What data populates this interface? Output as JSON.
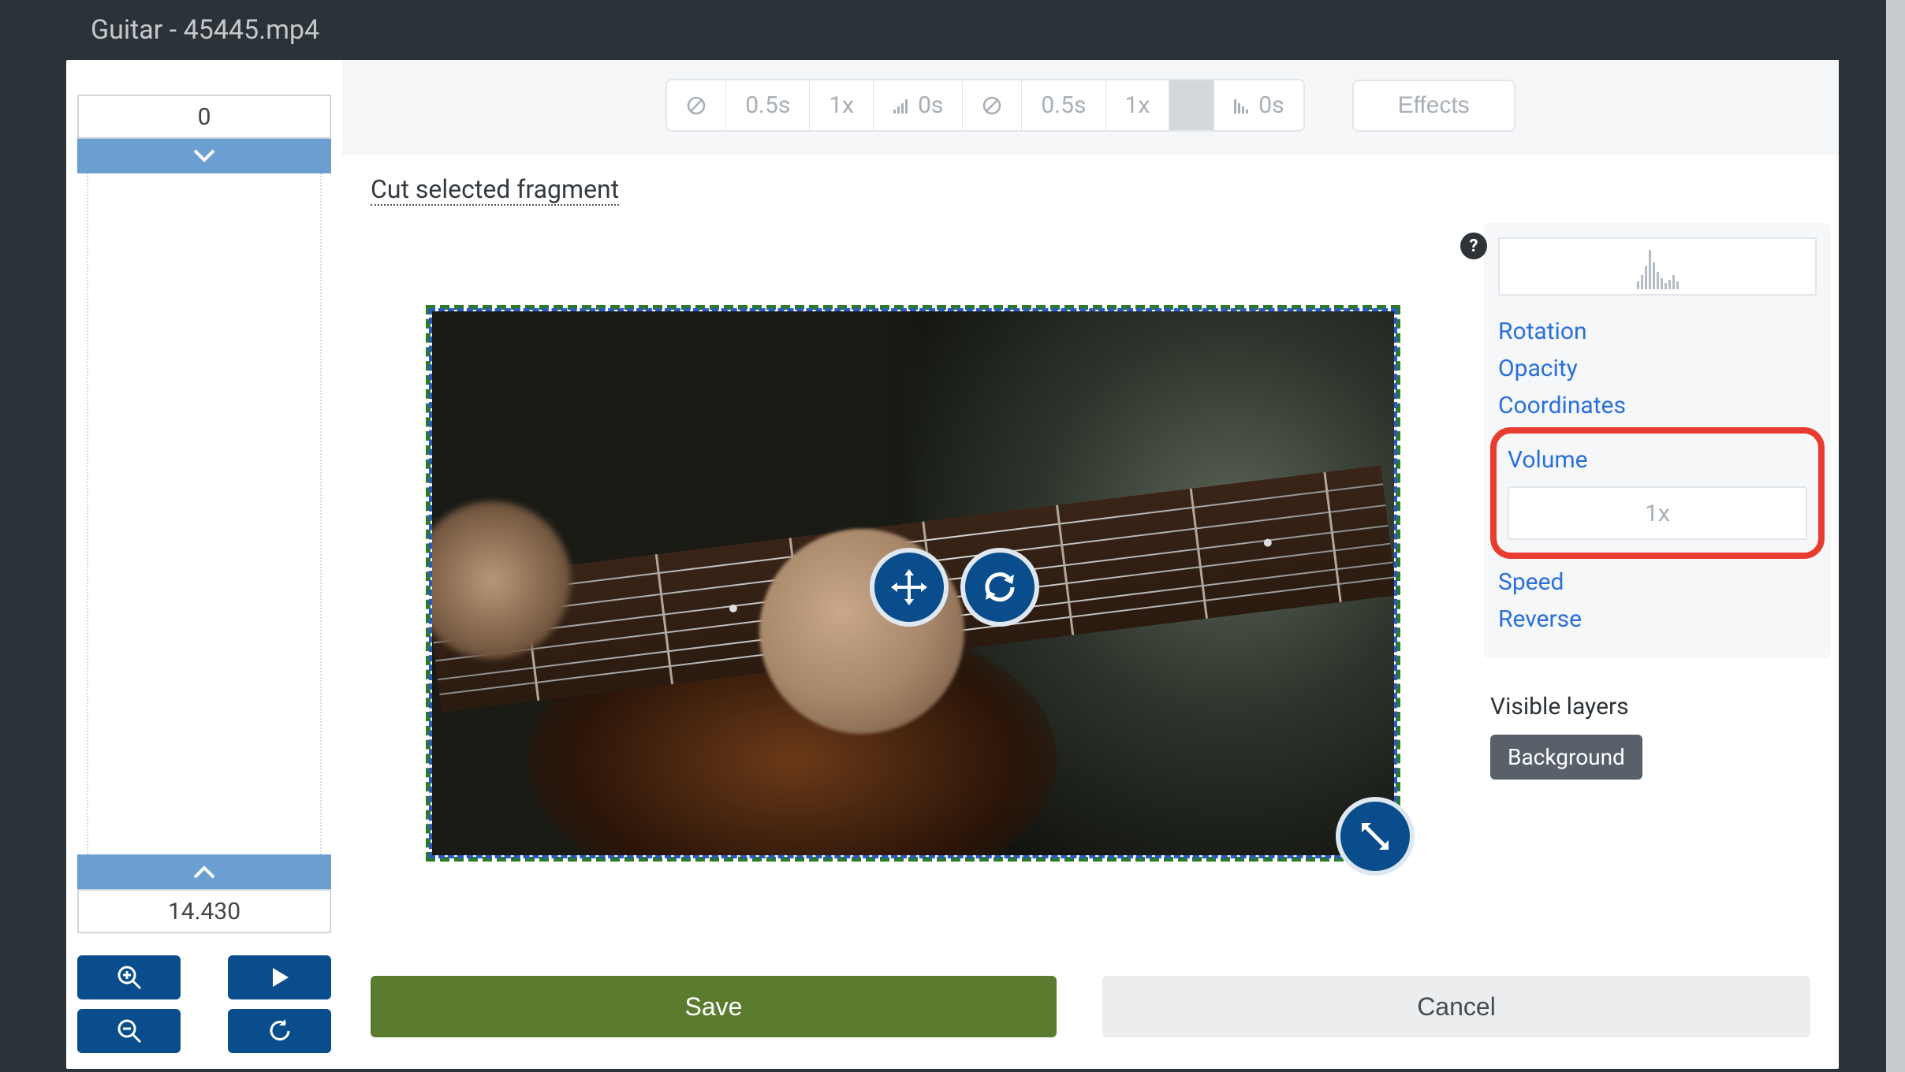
{
  "title": "Guitar - 45445.mp4",
  "timeline": {
    "start": "0",
    "end": "14.430"
  },
  "toolbar": {
    "group_a": {
      "duration": "0.5s",
      "speed": "1x",
      "fade": "0s"
    },
    "group_b": {
      "duration": "0.5s",
      "speed": "1x",
      "fade": "0s"
    },
    "effects_label": "Effects"
  },
  "cut_link": "Cut selected fragment",
  "help_icon": "?",
  "properties": {
    "rotation": "Rotation",
    "opacity": "Opacity",
    "coordinates": "Coordinates",
    "volume_label": "Volume",
    "volume_value": "1x",
    "speed": "Speed",
    "reverse": "Reverse"
  },
  "visible_layers": {
    "label": "Visible layers",
    "items": [
      "Background"
    ]
  },
  "buttons": {
    "save": "Save",
    "cancel": "Cancel"
  }
}
